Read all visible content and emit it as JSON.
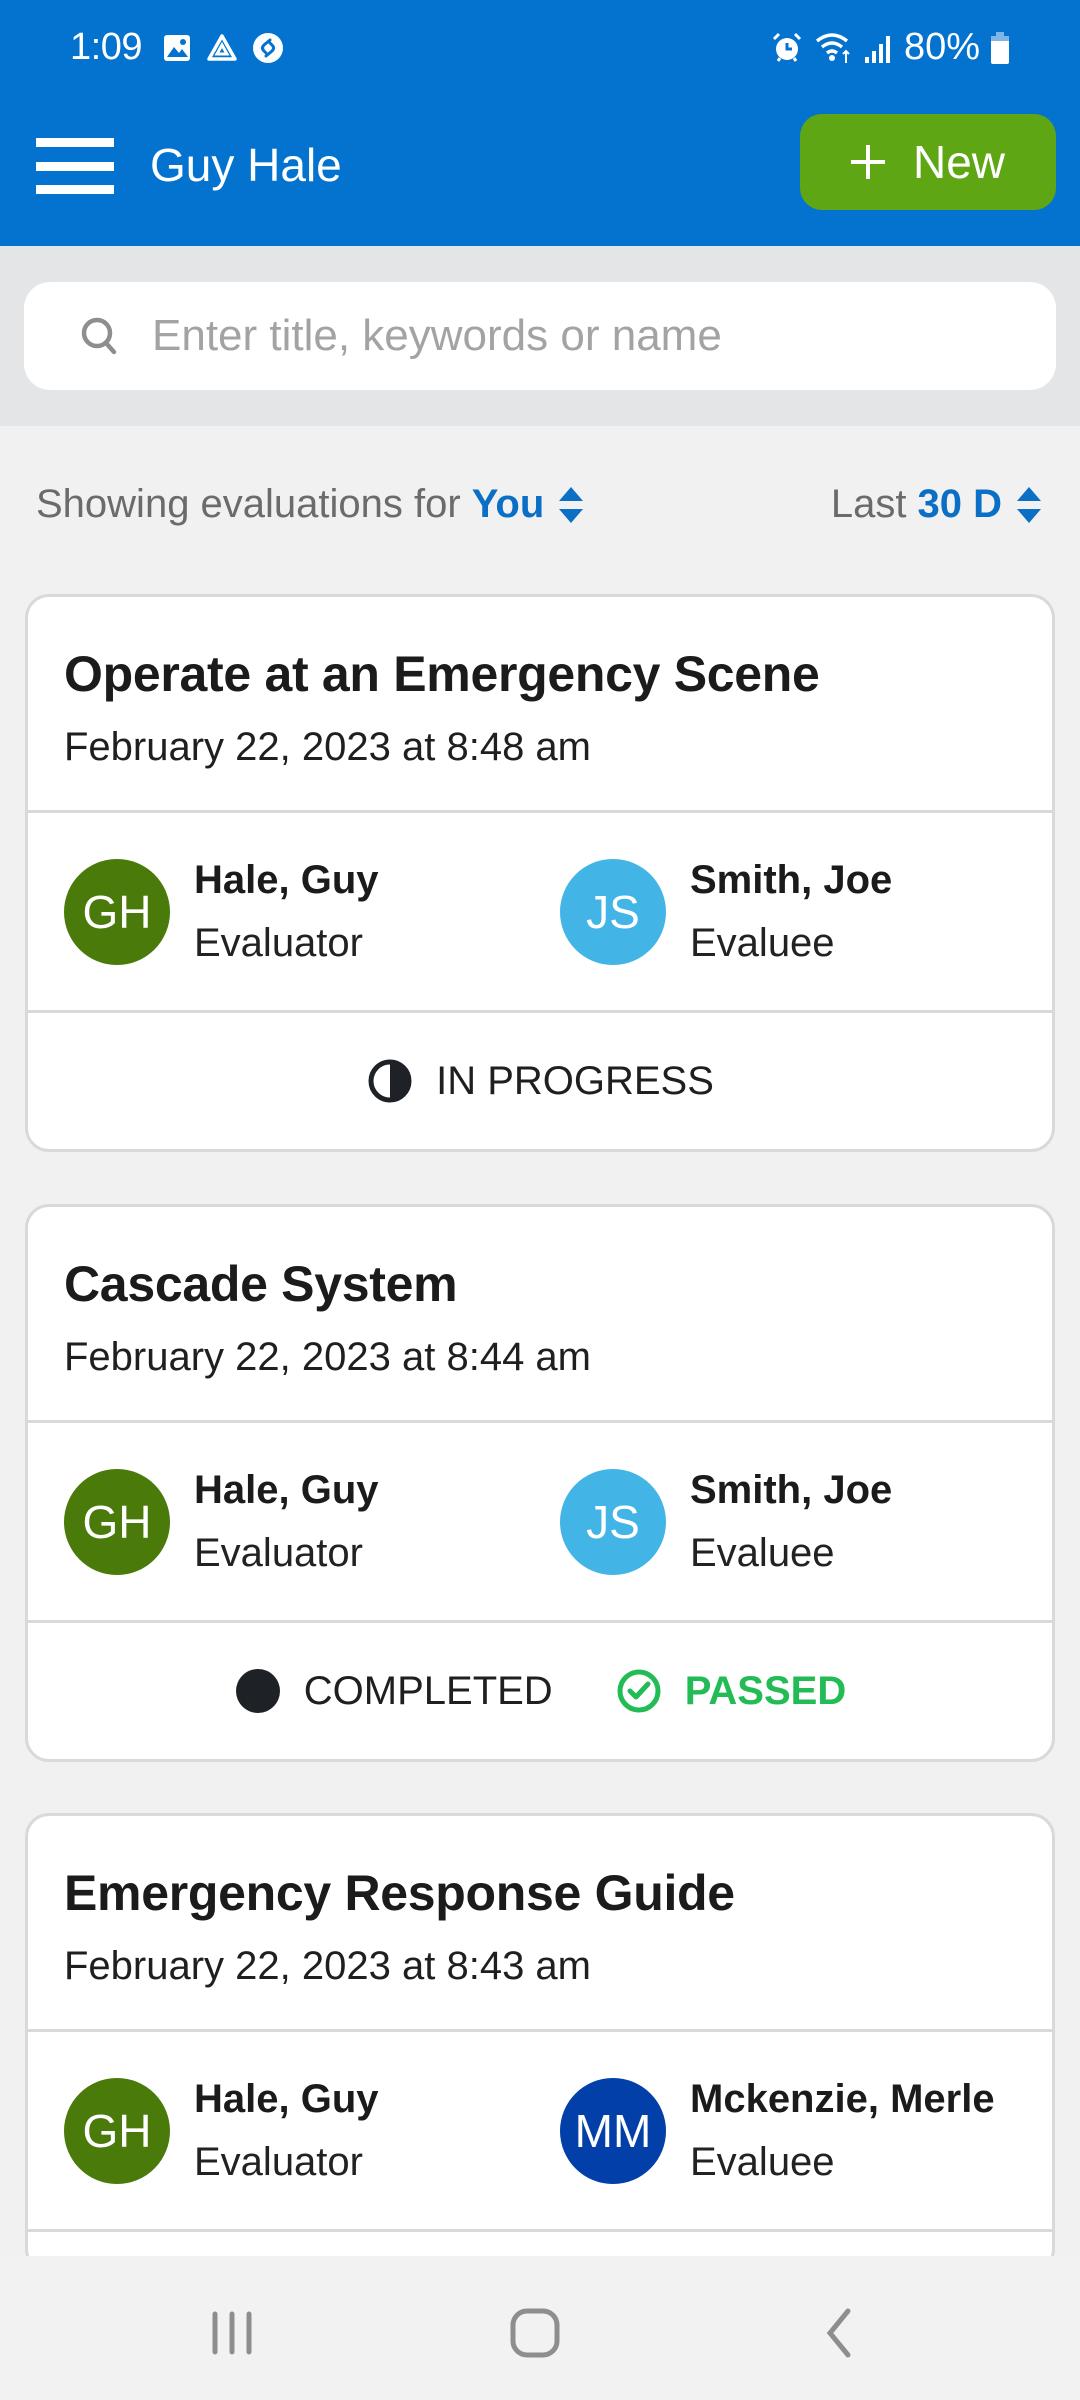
{
  "status_bar": {
    "time": "1:09",
    "battery": "80%",
    "left_icons": [
      "gallery-icon",
      "drive-icon",
      "shazam-icon"
    ],
    "right_icons": [
      "alarm-icon",
      "wifi-icon",
      "signal-icon",
      "battery-icon"
    ]
  },
  "app_bar": {
    "title": "Guy Hale",
    "new_button_label": "New"
  },
  "search": {
    "placeholder": "Enter title, keywords or name",
    "value": ""
  },
  "filters": {
    "showing_prefix": "Showing evaluations for",
    "showing_value": "You",
    "range_prefix": "Last",
    "range_value": "30 D"
  },
  "colors": {
    "primary": "#0373cf",
    "new_button": "#5fa614",
    "link_blue": "#0a6fc5",
    "passed_green": "#22bb55",
    "avatar_gh": "#4a7a0a",
    "avatar_js": "#42b4e6",
    "avatar_mm": "#023fa8"
  },
  "evaluations": [
    {
      "title": "Operate at an Emergency Scene",
      "date": "February 22, 2023 at 8:48 am",
      "evaluator": {
        "initials": "GH",
        "name": "Hale, Guy",
        "role": "Evaluator"
      },
      "evaluee": {
        "initials": "JS",
        "name": "Smith, Joe",
        "role": "Evaluee"
      },
      "status": "IN PROGRESS",
      "result": ""
    },
    {
      "title": "Cascade System",
      "date": "February 22, 2023 at 8:44 am",
      "evaluator": {
        "initials": "GH",
        "name": "Hale, Guy",
        "role": "Evaluator"
      },
      "evaluee": {
        "initials": "JS",
        "name": "Smith, Joe",
        "role": "Evaluee"
      },
      "status": "COMPLETED",
      "result": "PASSED"
    },
    {
      "title": "Emergency Response Guide",
      "date": "February 22, 2023 at 8:43 am",
      "evaluator": {
        "initials": "GH",
        "name": "Hale, Guy",
        "role": "Evaluator"
      },
      "evaluee": {
        "initials": "MM",
        "name": "Mckenzie, Merle",
        "role": "Evaluee"
      },
      "status": "",
      "result": ""
    }
  ]
}
